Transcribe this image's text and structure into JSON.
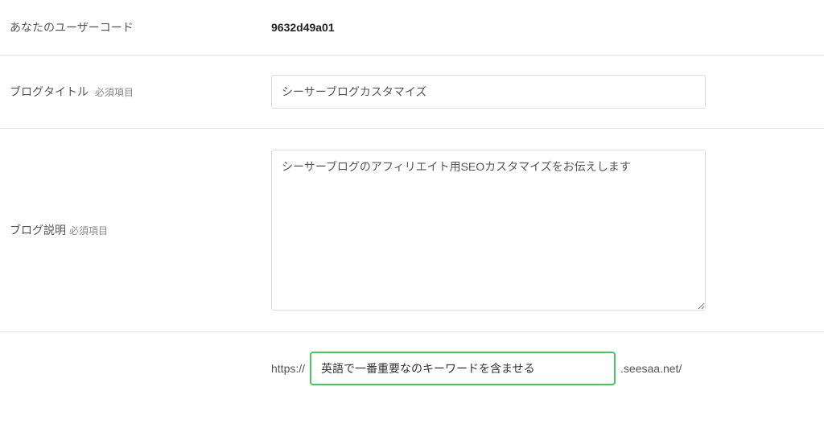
{
  "fields": {
    "user_code": {
      "label": "あなたのユーザーコード",
      "value": "9632d49a01"
    },
    "blog_title": {
      "label": "ブログタイトル",
      "required_tag": "必須項目",
      "value": "シーサーブログカスタマイズ"
    },
    "blog_description": {
      "label": "ブログ説明",
      "required_tag": "必須項目",
      "value": "シーサーブログのアフィリエイト用SEOカスタマイズをお伝えします"
    },
    "hostname": {
      "prefix": "https://",
      "value": "英語で一番重要なのキーワードを含ませる",
      "suffix": ".seesaa.net/"
    }
  }
}
